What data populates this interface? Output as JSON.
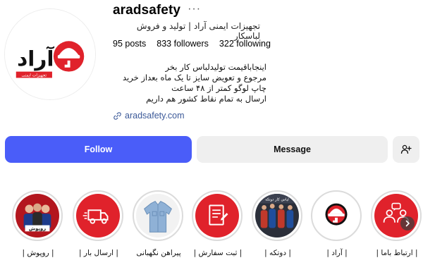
{
  "profile": {
    "username": "aradsafety",
    "more_glyph": "···",
    "category": "تجهیزات ایمنی آراد | تولید و فروش لباسکار",
    "stats": {
      "posts": "95 posts",
      "followers": "833 followers",
      "following": "322 following"
    },
    "bio_lines": [
      "اینجاباقیمت تولیدلباس کار بخر",
      "مرجوع و تعویض سایز تا یک ماه بعداز خرید",
      "چاپ لوگو کمتر از ۴۸ ساعت",
      "ارسال به تمام نقاط کشور هم داریم"
    ],
    "link": "aradsafety.com",
    "logo_text": "آراد",
    "logo_subtext": "تجهیزات ایمنی"
  },
  "actions": {
    "follow": "Follow",
    "message": "Message",
    "add_user_icon": "person-add-icon"
  },
  "highlights": [
    {
      "label": "| روپوش |",
      "title_text": "روپوش",
      "icon": "people-photo"
    },
    {
      "label": "| ارسال بار |",
      "icon": "truck-icon"
    },
    {
      "label": "پیراهن نگهبانی",
      "icon": "shirt-photo"
    },
    {
      "label": "| ثبت سفارش |",
      "icon": "order-form-icon"
    },
    {
      "label": "| دوتکه |",
      "title_text": "لباس کار دوتکه",
      "icon": "workers-photo"
    },
    {
      "label": "| آراد |",
      "icon": "brand-logo"
    },
    {
      "label": "| ارتباط باما |",
      "icon": "contact-people-icon"
    }
  ],
  "colors": {
    "accent": "#4a5df9",
    "brand_red": "#e0222b",
    "dark_red": "#b3161e",
    "link": "#3b5998"
  }
}
